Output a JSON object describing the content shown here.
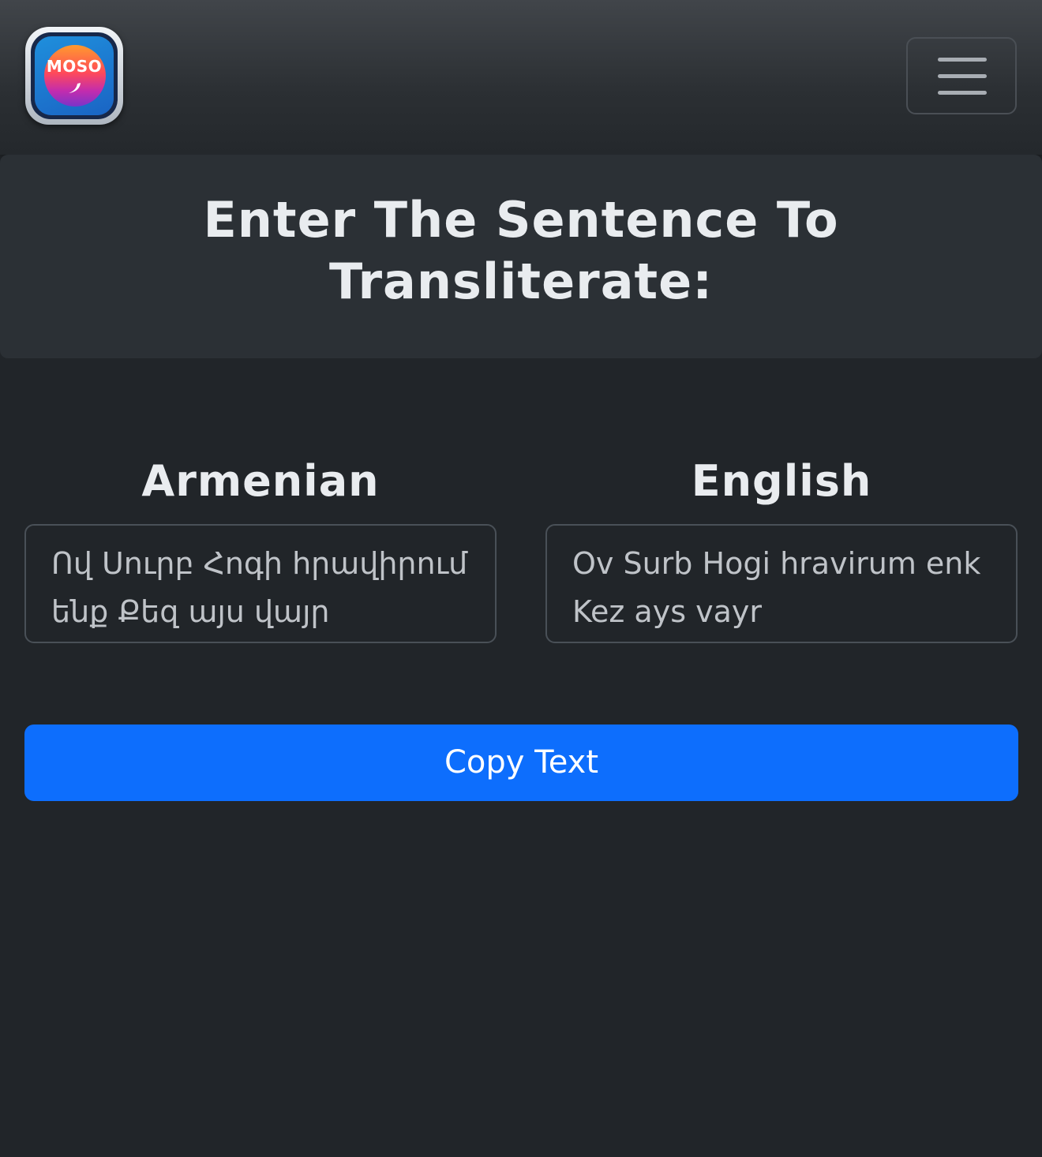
{
  "navbar": {
    "logo_text": "MOSO",
    "menu_icon": "hamburger-menu-icon"
  },
  "header": {
    "title": "Enter The Sentence To Transliterate:"
  },
  "source": {
    "label": "Armenian",
    "text": "Ով Սուրբ Հոգի հրավիրում ենք Քեզ այս վայր"
  },
  "target": {
    "label": "English",
    "text": "Ov Surb Hogi hravirum enk Kez ays vayr"
  },
  "actions": {
    "copy_label": "Copy Text"
  },
  "colors": {
    "background": "#212529",
    "card": "#2b3035",
    "primary_button": "#0d6efd",
    "text": "#e9ecef"
  }
}
